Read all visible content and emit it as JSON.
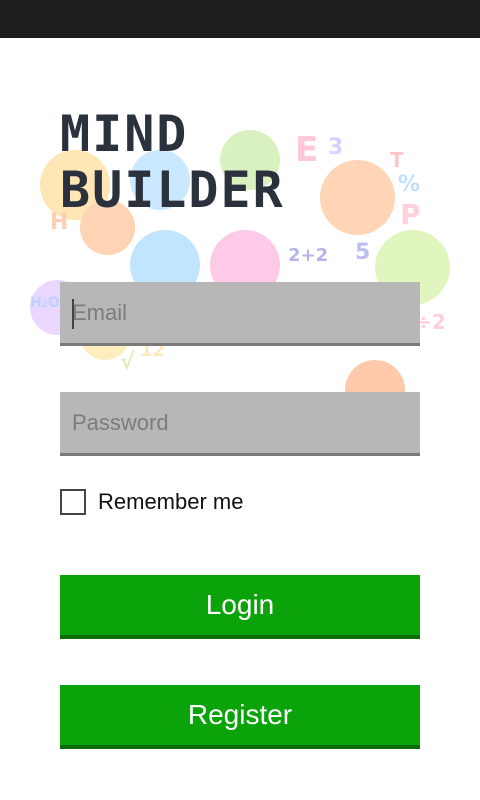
{
  "app": {
    "logo_line1": "MIND",
    "logo_line2": "BUILDER"
  },
  "form": {
    "email_placeholder": "Email",
    "password_placeholder": "Password",
    "remember_label": "Remember me",
    "remember_checked": false,
    "login_label": "Login",
    "register_label": "Register"
  },
  "background_art": {
    "glyphs": [
      "E",
      "3",
      "T",
      "%",
      "P",
      "2+2",
      "H",
      "5",
      "√",
      "÷2",
      "12",
      "H₂O"
    ]
  },
  "colors": {
    "statusbar": "#1e1e1e",
    "field_bg": "#b7b7b7",
    "button_green": "#0aa30a",
    "logo": "#2b313d"
  }
}
